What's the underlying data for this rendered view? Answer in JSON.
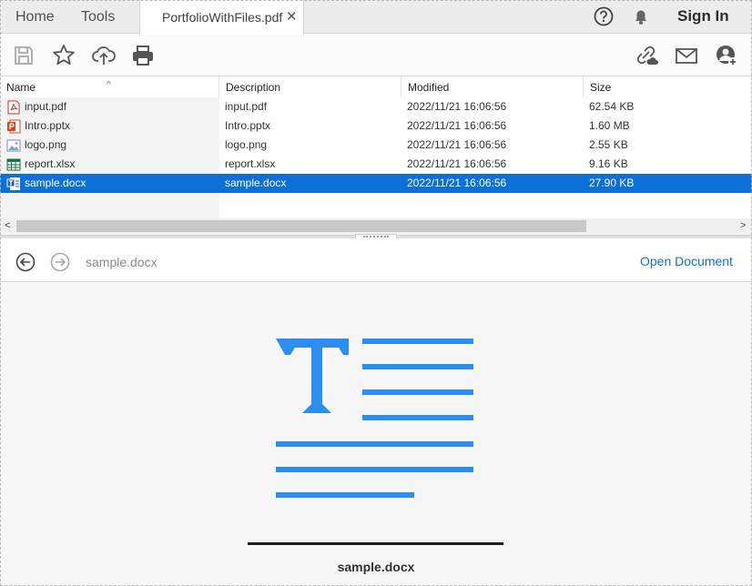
{
  "menu": {
    "home": "Home",
    "tools": "Tools",
    "sign_in": "Sign In"
  },
  "tab": {
    "title": "PortfolioWithFiles.pdf",
    "close": "✕"
  },
  "toolbar_icons": [
    "save-icon",
    "star-icon",
    "upload-cloud-icon",
    "print-icon",
    "link-cloud-icon",
    "mail-icon",
    "add-user-icon"
  ],
  "table": {
    "columns": [
      "Name",
      "Description",
      "Modified",
      "Size"
    ],
    "sort_indicator": "^",
    "rows": [
      {
        "name": "input.pdf",
        "description": "input.pdf",
        "modified": "2022/11/21 16:06:56",
        "size": "62.54 KB",
        "icon": "pdf-file-icon"
      },
      {
        "name": "Intro.pptx",
        "description": "Intro.pptx",
        "modified": "2022/11/21 16:06:56",
        "size": "1.60 MB",
        "icon": "pptx-file-icon"
      },
      {
        "name": "logo.png",
        "description": "logo.png",
        "modified": "2022/11/21 16:06:56",
        "size": "2.55 KB",
        "icon": "image-file-icon"
      },
      {
        "name": "report.xlsx",
        "description": "report.xlsx",
        "modified": "2022/11/21 16:06:56",
        "size": "9.16 KB",
        "icon": "xlsx-file-icon"
      },
      {
        "name": "sample.docx",
        "description": "sample.docx",
        "modified": "2022/11/21 16:06:56",
        "size": "27.90 KB",
        "icon": "docx-file-icon",
        "selected": true
      }
    ]
  },
  "scroll": {
    "left": "<",
    "right": ">"
  },
  "nav": {
    "current_file": "sample.docx",
    "open_document": "Open Document"
  },
  "preview": {
    "filename": "sample.docx"
  },
  "colors": {
    "selection": "#0c70d8",
    "link": "#1473c5",
    "docx_art": "#2b8ef0"
  }
}
